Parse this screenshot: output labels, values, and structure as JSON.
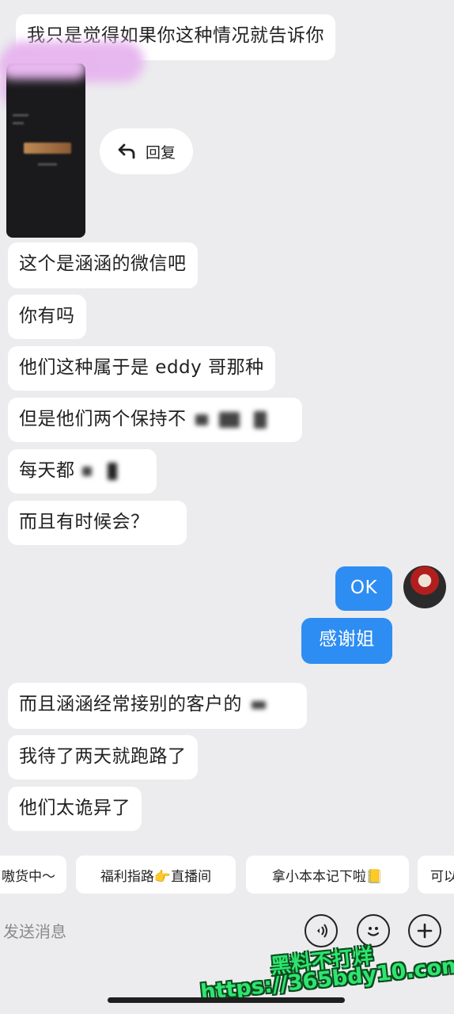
{
  "messages": {
    "m1": "我只是觉得如果你这种情况就告诉你",
    "m2": "这个是涵涵的微信吧",
    "m3": "你有吗",
    "m4": "他们这种属于是 eddy 哥那种",
    "m5": "但是他们两个保持不",
    "m6": "每天都",
    "m7": "而且有时候会？",
    "m8": "而且涵涵经常接别的客户的",
    "m9": "我待了两天就跑路了",
    "m10": "他们太诡异了"
  },
  "my_messages": {
    "ok": "OK",
    "thanks": "感谢姐"
  },
  "reply_button": {
    "label": "回复",
    "icon": "reply-arrow-icon"
  },
  "quick_replies": [
    "嗷货中～",
    "福利指路👉直播间",
    "拿小本本记下啦📒",
    "可以"
  ],
  "input": {
    "placeholder": "发送消息"
  },
  "icons": [
    "voice-icon",
    "emoji-icon",
    "plus-icon"
  ],
  "watermark": {
    "line1": "黑料不打烊",
    "line2": "https://365bdy10.com"
  },
  "colors": {
    "accent": "#2e8df2",
    "background": "#ececee",
    "watermark": "#2ee56f"
  }
}
